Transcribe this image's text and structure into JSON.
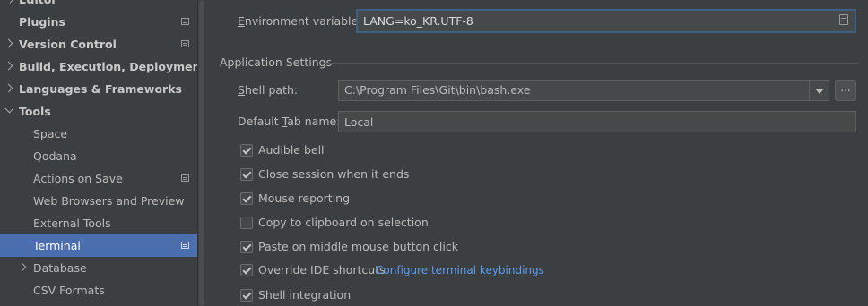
{
  "sidebar": {
    "items": [
      {
        "label": "Editor"
      },
      {
        "label": "Plugins"
      },
      {
        "label": "Version Control"
      },
      {
        "label": "Build, Execution, Deployment"
      },
      {
        "label": "Languages & Frameworks"
      },
      {
        "label": "Tools"
      },
      {
        "label": "Space"
      },
      {
        "label": "Qodana"
      },
      {
        "label": "Actions on Save"
      },
      {
        "label": "Web Browsers and Preview"
      },
      {
        "label": "External Tools"
      },
      {
        "label": "Terminal"
      },
      {
        "label": "Database"
      },
      {
        "label": "CSV Formats"
      }
    ],
    "selected": "Terminal"
  },
  "env": {
    "label_first": "E",
    "label_rest": "nvironment variables:",
    "value": "LANG=ko_KR.UTF-8"
  },
  "app_settings": {
    "title": "Application Settings",
    "shell_path": {
      "label_first": "S",
      "label_rest": "hell path:",
      "value": "C:\\Program Files\\Git\\bin\\bash.exe",
      "browse_label": "..."
    },
    "tab_name": {
      "label_pre": "Default ",
      "label_u": "T",
      "label_rest": "ab name:",
      "value": "Local"
    },
    "checkboxes": [
      {
        "label": "Audible bell",
        "checked": true
      },
      {
        "label": "Close session when it ends",
        "checked": true
      },
      {
        "label": "Mouse reporting",
        "checked": true
      },
      {
        "label": "Copy to clipboard on selection",
        "checked": false
      },
      {
        "label": "Paste on middle mouse button click",
        "checked": true
      },
      {
        "label": "Override IDE shortcuts",
        "checked": true
      },
      {
        "label": "Shell integration",
        "checked": true
      }
    ],
    "keybindings_link": "Configure terminal keybindings"
  },
  "colors": {
    "background": "#3c3f41",
    "selection": "#4b6eaf",
    "link": "#589df6",
    "focus_border": "#3d6185"
  }
}
